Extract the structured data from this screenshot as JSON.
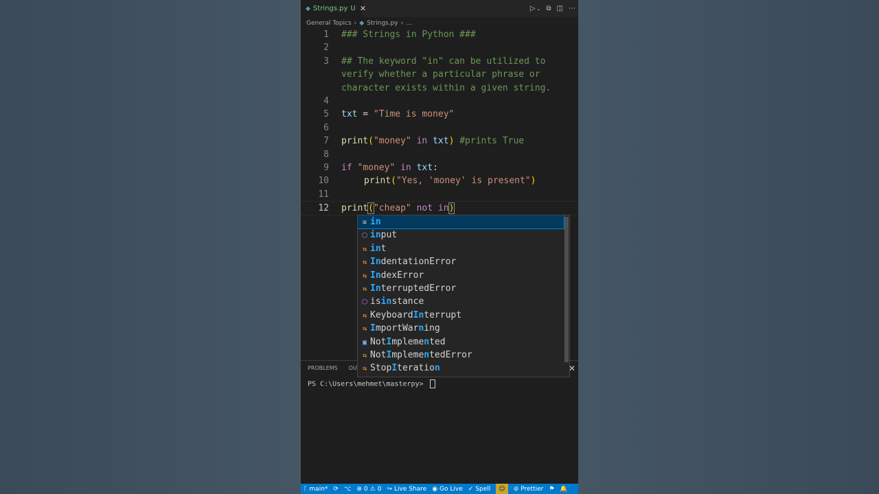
{
  "tab": {
    "icon": "python-icon",
    "filename": "Strings.py",
    "modified": "U"
  },
  "breadcrumb": {
    "folder": "General Topics",
    "file": "Strings.py",
    "more": "..."
  },
  "code": {
    "line1": "### Strings in Python ###",
    "line3a": "## The keyword \"in\" can be utilized to",
    "line3b": "verify whether a particular phrase or",
    "line3c": "character exists within a given string.",
    "l5_var": "txt",
    "l5_op": " = ",
    "l5_str": "\"Time is money\"",
    "l7_fn": "print",
    "l7_str": "\"money\"",
    "l7_kw": " in ",
    "l7_var": "txt",
    "l7_cm": " #prints True",
    "l9_kw": "if ",
    "l9_str": "\"money\"",
    "l9_kw2": " in ",
    "l9_var": "txt",
    "l9_colon": ":",
    "l10_fn": "print",
    "l10_str": "\"Yes, 'money' is present\"",
    "l12_fn": "print",
    "l12_str": "\"cheap\"",
    "l12_kw": " not in",
    "paren_open": "(",
    "paren_close": ")"
  },
  "line_numbers": [
    "1",
    "2",
    "3",
    "4",
    "5",
    "6",
    "7",
    "8",
    "9",
    "10",
    "11",
    "12"
  ],
  "suggestions": [
    {
      "pre": "",
      "hl": "in",
      "post": "",
      "kind": "keyword"
    },
    {
      "pre": "",
      "hl": "in",
      "post": "put",
      "kind": "function"
    },
    {
      "pre": "",
      "hl": "in",
      "post": "t",
      "kind": "class"
    },
    {
      "pre": "",
      "hl": "In",
      "post": "dentationError",
      "kind": "class"
    },
    {
      "pre": "",
      "hl": "In",
      "post": "dexError",
      "kind": "class"
    },
    {
      "pre": "",
      "hl": "In",
      "post": "terruptedError",
      "kind": "class"
    },
    {
      "pre": "is",
      "hl": "in",
      "post": "stance",
      "kind": "function"
    },
    {
      "pre": "Keyboard",
      "hl": "In",
      "post": "terrupt",
      "kind": "class"
    },
    {
      "pre": "",
      "hl": "I",
      "post": "mportWar",
      "hl2": "n",
      "post2": "ing",
      "kind": "class"
    },
    {
      "pre": "Not",
      "hl": "I",
      "post": "mpleme",
      "hl2": "n",
      "post2": "ted",
      "kind": "constant"
    },
    {
      "pre": "Not",
      "hl": "I",
      "post": "mpleme",
      "hl2": "n",
      "post2": "tedError",
      "kind": "class"
    },
    {
      "pre": "Stop",
      "hl": "I",
      "post": "teratio",
      "hl2": "n",
      "post2": "",
      "kind": "class"
    }
  ],
  "panel": {
    "tab_problems": "PROBLEMS",
    "tab_output": "OUT",
    "prompt": "PS C:\\Users\\mehmet\\masterpy> "
  },
  "status": {
    "branch": "main*",
    "errors": "0",
    "warnings": "0",
    "live_share": "Live Share",
    "go_live": "Go Live",
    "spell": "Spell",
    "prettier": "Prettier"
  }
}
